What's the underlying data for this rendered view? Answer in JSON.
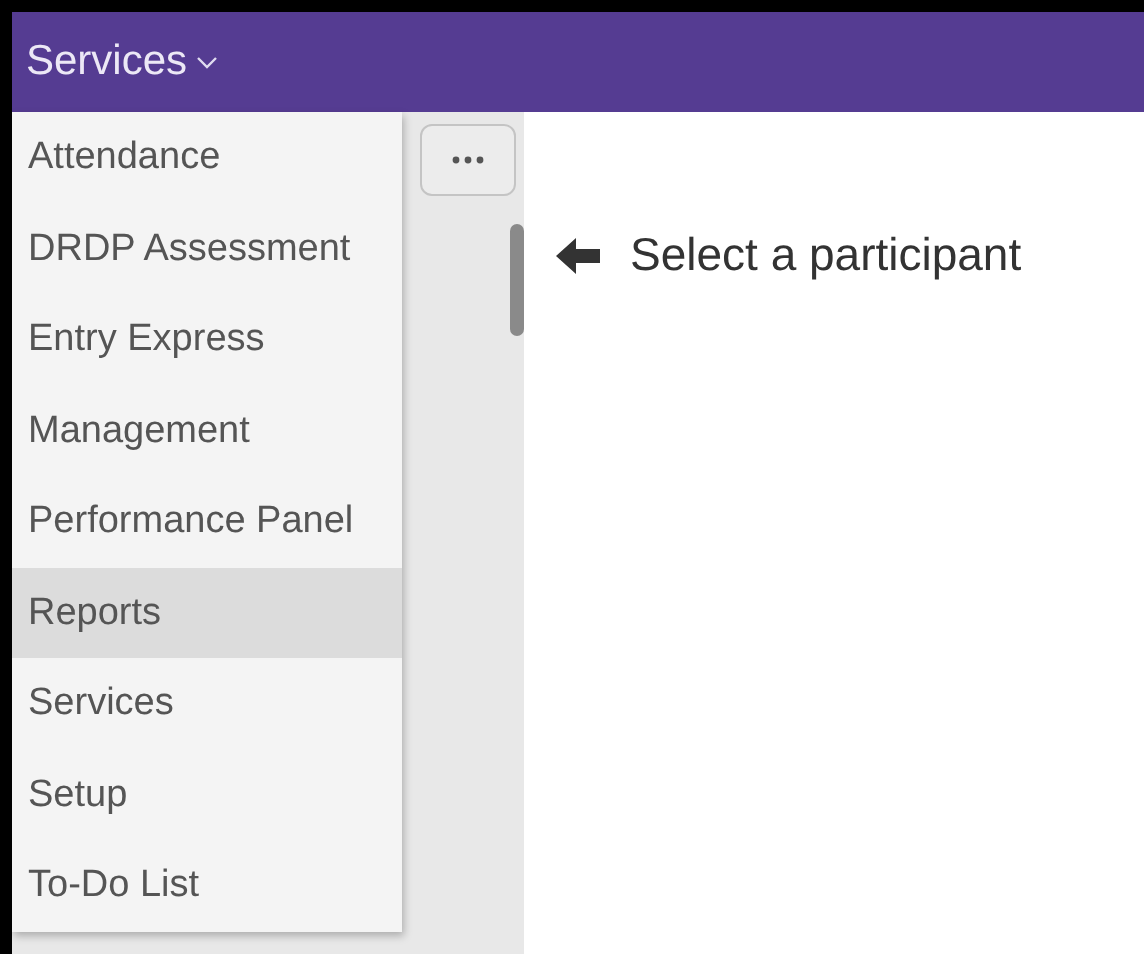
{
  "header": {
    "title": "Services",
    "menu_open": true
  },
  "menu": {
    "items": [
      {
        "label": "Attendance",
        "selected": false
      },
      {
        "label": "DRDP Assessment",
        "selected": false
      },
      {
        "label": "Entry Express",
        "selected": false
      },
      {
        "label": "Management",
        "selected": false
      },
      {
        "label": "Performance Panel",
        "selected": false
      },
      {
        "label": "Reports",
        "selected": true
      },
      {
        "label": "Services",
        "selected": false
      },
      {
        "label": "Setup",
        "selected": false
      },
      {
        "label": "To-Do List",
        "selected": false
      }
    ]
  },
  "content": {
    "hint": "Select a participant"
  }
}
